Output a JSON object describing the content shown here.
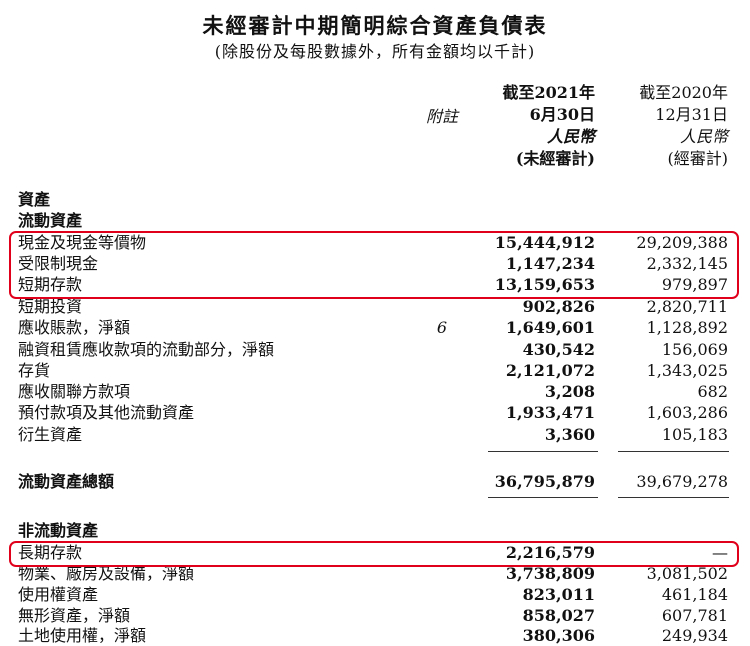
{
  "title": "未經審計中期簡明綜合資產負債表",
  "subtitle": "(除股份及每股數據外，所有金額均以千計)",
  "columns": {
    "note": "附註",
    "col1": {
      "line1": "截至2021年",
      "line2": "6月30日",
      "currency": "人民幣",
      "audit": "(未經審計)"
    },
    "col2": {
      "line1": "截至2020年",
      "line2": "12月31日",
      "currency": "人民幣",
      "audit": "(經審計)"
    }
  },
  "sections": {
    "assets": "資產",
    "current_assets": "流動資產",
    "non_current_assets": "非流動資產"
  },
  "current_rows": [
    {
      "label": "現金及現金等價物",
      "note": "",
      "v1": "15,444,912",
      "v2": "29,209,388"
    },
    {
      "label": "受限制現金",
      "note": "",
      "v1": "1,147,234",
      "v2": "2,332,145"
    },
    {
      "label": "短期存款",
      "note": "",
      "v1": "13,159,653",
      "v2": "979,897"
    },
    {
      "label": "短期投資",
      "note": "",
      "v1": "902,826",
      "v2": "2,820,711"
    },
    {
      "label": "應收賬款，淨額",
      "note": "6",
      "v1": "1,649,601",
      "v2": "1,128,892"
    },
    {
      "label": "融資租賃應收款項的流動部分，淨額",
      "note": "",
      "v1": "430,542",
      "v2": "156,069"
    },
    {
      "label": "存貨",
      "note": "",
      "v1": "2,121,072",
      "v2": "1,343,025"
    },
    {
      "label": "應收關聯方款項",
      "note": "",
      "v1": "3,208",
      "v2": "682"
    },
    {
      "label": "預付款項及其他流動資產",
      "note": "",
      "v1": "1,933,471",
      "v2": "1,603,286"
    },
    {
      "label": "衍生資產",
      "note": "",
      "v1": "3,360",
      "v2": "105,183"
    }
  ],
  "total_current": {
    "label": "流動資產總額",
    "v1": "36,795,879",
    "v2": "39,679,278"
  },
  "non_current_rows": [
    {
      "label": "長期存款",
      "note": "",
      "v1": "2,216,579",
      "v2": "—"
    },
    {
      "label": "物業、廠房及設備，淨額",
      "note": "",
      "v1": "3,738,809",
      "v2": "3,081,502"
    },
    {
      "label": "使用權資產",
      "note": "",
      "v1": "823,011",
      "v2": "461,184"
    },
    {
      "label": "無形資產，淨額",
      "note": "",
      "v1": "858,027",
      "v2": "607,781"
    },
    {
      "label": "土地使用權，淨額",
      "note": "",
      "v1": "380,306",
      "v2": "249,934"
    }
  ],
  "highlight_color": "#e0001b"
}
